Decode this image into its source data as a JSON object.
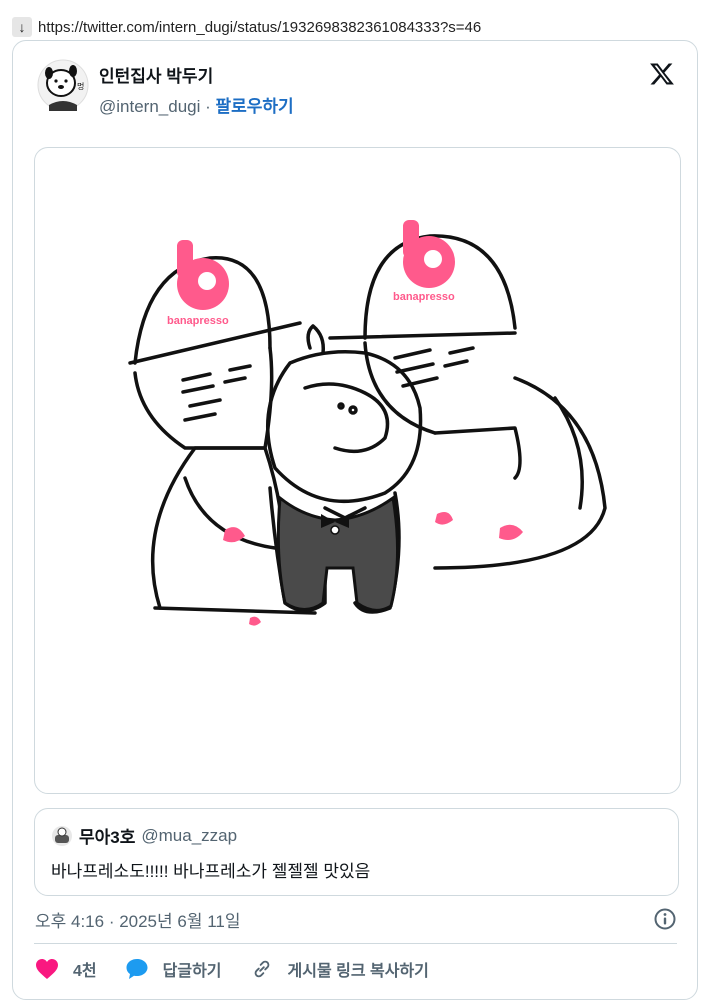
{
  "browser": {
    "back_arrow": "↓",
    "url": "https://twitter.com/intern_dugi/status/1932698382361084333?s=46"
  },
  "tweet": {
    "display_name": "인턴집사 박두기",
    "handle": "@intern_dugi",
    "separator": " · ",
    "follow_label": "팔로우하기",
    "logo_icon": "x-logo-icon",
    "media": {
      "badge_letter": "b",
      "brand_text": "banapresso",
      "brand_color": "#ff5a8c"
    },
    "quote": {
      "display_name": "무아3호",
      "handle": "@mua_zzap",
      "text": "바나프레소도!!!!! 바나프레소가 젤젤젤 맛있음"
    },
    "timestamp": "오후 4:16 · 2025년 6월 11일",
    "actions": {
      "likes": "4천",
      "reply_label": "답글하기",
      "copy_link_label": "게시물 링크 복사하기"
    }
  },
  "colors": {
    "like": "#f91880",
    "reply": "#1d9bf0",
    "link": "#1d6ec4",
    "muted": "#536471"
  }
}
